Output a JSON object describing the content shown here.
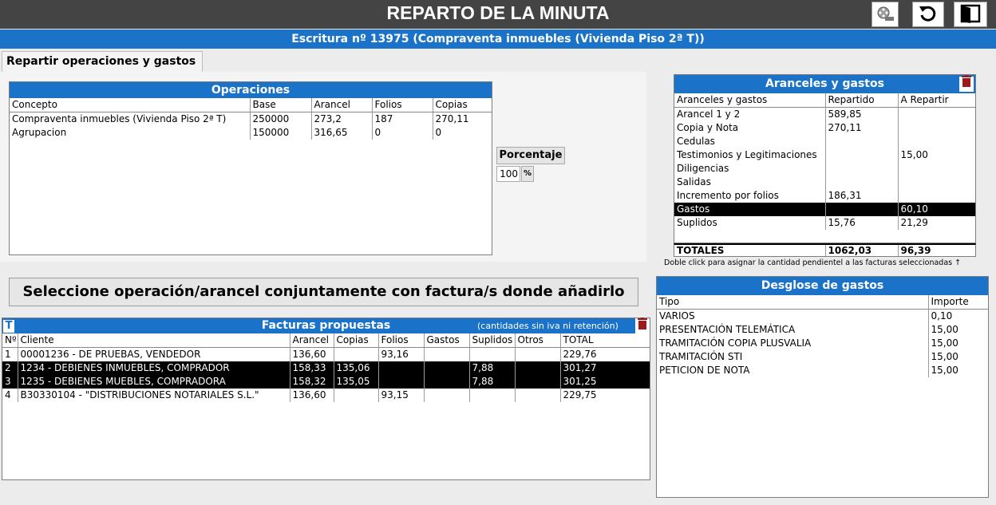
{
  "header": {
    "title": "REPARTO DE LA MINUTA",
    "subtitle": "Escritura nº 13975 (Compraventa inmuebles (Vivienda Piso 2ª T))",
    "buttons": [
      {
        "name": "film-icon"
      },
      {
        "name": "refresh-icon"
      },
      {
        "name": "exit-door-icon"
      }
    ]
  },
  "tab": {
    "label": "Repartir operaciones y gastos"
  },
  "operaciones": {
    "title": "Operaciones",
    "columns": [
      "Concepto",
      "Base",
      "Arancel",
      "Folios",
      "Copias"
    ],
    "rows": [
      [
        "Compraventa inmuebles (Vivienda Piso 2ª T)",
        "250000",
        "273,2",
        "187",
        "270,11"
      ],
      [
        "Agrupacion",
        "150000",
        "316,65",
        "0",
        "0"
      ]
    ]
  },
  "porcentaje": {
    "label": "Porcentaje",
    "value": "100",
    "button": "%"
  },
  "select_button": "Seleccione operación/arancel conjuntamente con factura/s donde añadirlo",
  "facturas": {
    "title": "Facturas propuestas",
    "note": "(cantidades sin iva ni retención)",
    "t_icon": "T",
    "columns": [
      "Nº",
      "Cliente",
      "Arancel",
      "Copias",
      "Folios",
      "Gastos",
      "Suplidos",
      "Otros",
      "TOTAL"
    ],
    "rows": [
      [
        "1",
        "00001236 - DE PRUEBAS, VENDEDOR",
        "136,60",
        "",
        "93,16",
        "",
        "",
        "",
        "229,76"
      ],
      [
        "2",
        "1234 - DEBIENES INMUEBLES, COMPRADOR",
        "158,33",
        "135,06",
        "",
        "",
        "7,88",
        "",
        "301,27"
      ],
      [
        "3",
        "1235 - DEBIENES MUEBLES, COMPRADORA",
        "158,32",
        "135,05",
        "",
        "",
        "7,88",
        "",
        "301,25"
      ],
      [
        "4",
        "B30330104 - \"DISTRIBUCIONES NOTARIALES S.L.\"",
        "136,60",
        "",
        "93,15",
        "",
        "",
        "",
        "229,75"
      ]
    ]
  },
  "aranceles": {
    "title": "Aranceles y gastos",
    "columns": [
      "Aranceles y gastos",
      "Repartido",
      "A Repartir"
    ],
    "rows": [
      [
        "Arancel 1 y 2",
        "589,85",
        ""
      ],
      [
        "Copia y Nota",
        "270,11",
        ""
      ],
      [
        "Cedulas",
        "",
        ""
      ],
      [
        "Testimonios y Legitimaciones",
        "",
        "15,00"
      ],
      [
        "Diligencias",
        "",
        ""
      ],
      [
        "Salidas",
        "",
        ""
      ],
      [
        "Incremento por folios",
        "186,31",
        ""
      ],
      [
        "Gastos",
        "",
        "60,10"
      ],
      [
        "Suplidos",
        "15,76",
        "21,29"
      ]
    ],
    "totals": [
      "TOTALES",
      "1062,03",
      "96,39"
    ],
    "hint": "Doble click para asignar la cantidad pendientel a las facturas seleccionadas ↑"
  },
  "desglose": {
    "title": "Desglose de gastos",
    "columns": [
      "Tipo",
      "Importe"
    ],
    "rows": [
      [
        "VARIOS",
        "0,10"
      ],
      [
        "PRESENTACIÓN TELEMÁTICA",
        "15,00"
      ],
      [
        "TRAMITACIÓN COPIA PLUSVALIA",
        "15,00"
      ],
      [
        "TRAMITACIÓN STI",
        "15,00"
      ],
      [
        "PETICION DE NOTA",
        "15,00"
      ]
    ]
  },
  "colors": {
    "header_blue": "#1a73c9",
    "title_bar": "#444444",
    "trash_red": "#9b1b1b"
  }
}
